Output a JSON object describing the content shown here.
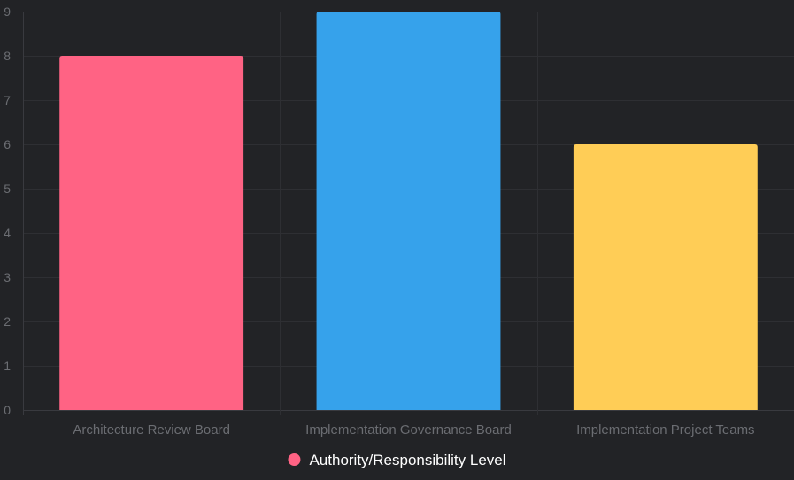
{
  "chart_data": {
    "type": "bar",
    "categories": [
      "Architecture Review Board",
      "Implementation Governance Board",
      "Implementation Project Teams"
    ],
    "series": [
      {
        "name": "Authority/Responsibility Level",
        "values": [
          8,
          9,
          6
        ],
        "colors": [
          "#ff6384",
          "#36a2eb",
          "#ffcd56"
        ]
      }
    ],
    "ylim": [
      0,
      9
    ],
    "yticks": [
      0,
      1,
      2,
      3,
      4,
      5,
      6,
      7,
      8,
      9
    ],
    "grid": true,
    "legend": {
      "position": "bottom",
      "marker_color": "#ff6384"
    }
  }
}
